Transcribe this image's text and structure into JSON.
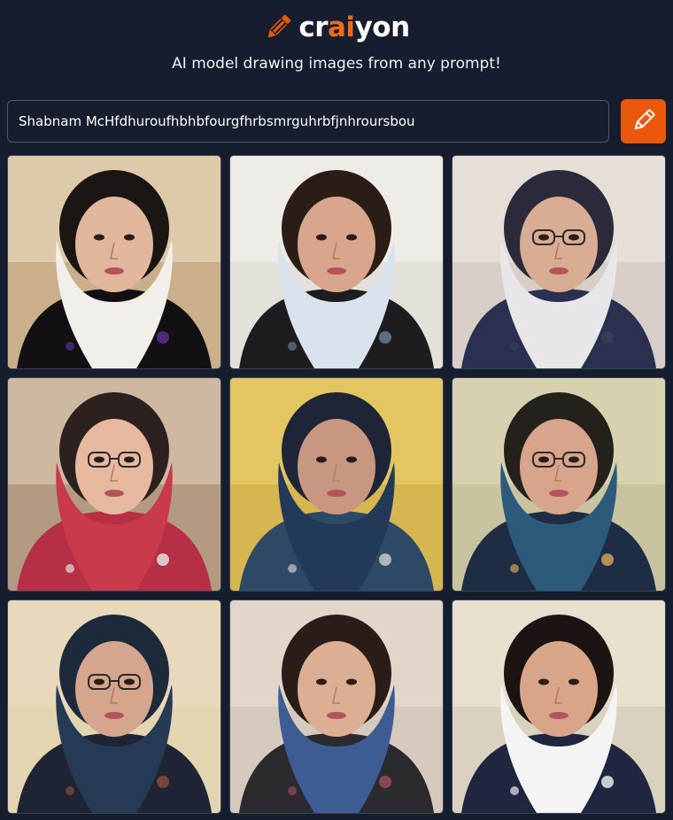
{
  "brand": {
    "logo_prefix": "cr",
    "logo_accent": "ai",
    "logo_suffix": "yon",
    "accent_color": "#ea580c",
    "logo_icon": "pencil-icon"
  },
  "tagline": "AI model drawing images from any prompt!",
  "search": {
    "value": "Shabnam McHfdhuroufhbhbfourgfhrbsmrguhrbfjnhroursbou",
    "button_icon": "pencil-icon"
  },
  "results": [
    {
      "bg": "#c9b08a",
      "wall": "#e7d6b8",
      "hair": "#1b1614",
      "face": "#e2b79e",
      "scarf": "#f2eee9",
      "body": "#121013",
      "accent": "#5a2f8a",
      "glasses": false
    },
    {
      "bg": "#e4e0da",
      "wall": "#f3f1ee",
      "hair": "#2a1d16",
      "face": "#d7a68c",
      "scarf": "#d9e3ee",
      "body": "#1d1c1f",
      "accent": "#6a7a8d",
      "glasses": false
    },
    {
      "bg": "#d7cfc8",
      "wall": "#ede5dd",
      "hair": "#2c2a3a",
      "face": "#d8ad93",
      "scarf": "#e9e6ea",
      "body": "#2a3150",
      "accent": "#3b3e5b",
      "glasses": true
    },
    {
      "bg": "#b59a82",
      "wall": "#d8c4ae",
      "hair": "#2b2220",
      "face": "#e7b9a0",
      "scarf": "#c83a4c",
      "body": "#b72f45",
      "accent": "#e0e0e0",
      "glasses": true
    },
    {
      "bg": "#d7b650",
      "wall": "#e8cc6a",
      "hair": "#1e2536",
      "face": "#c89781",
      "scarf": "#223a58",
      "body": "#2c4a66",
      "accent": "#c8c8c8",
      "glasses": false
    },
    {
      "bg": "#c8c4a0",
      "wall": "#dcd8b5",
      "hair": "#24201c",
      "face": "#d9a48c",
      "scarf": "#2d5a7a",
      "body": "#1f2d44",
      "accent": "#c9a35a",
      "glasses": true
    },
    {
      "bg": "#e3d4b2",
      "wall": "#eadcc0",
      "hair": "#1d2a3c",
      "face": "#d6a58d",
      "scarf": "#253a55",
      "body": "#1e2433",
      "accent": "#8c4a3a",
      "glasses": true
    },
    {
      "bg": "#d5cabd",
      "wall": "#e6dccf",
      "hair": "#2a1d18",
      "face": "#dcae93",
      "scarf": "#3d5c94",
      "body": "#2b2a2e",
      "accent": "#9b4b5e",
      "glasses": false
    },
    {
      "bg": "#d9d2c0",
      "wall": "#ece6d6",
      "hair": "#1c1412",
      "face": "#d9a588",
      "scarf": "#f4f4f4",
      "body": "#1f2740",
      "accent": "#e8e8ee",
      "glasses": false
    }
  ]
}
